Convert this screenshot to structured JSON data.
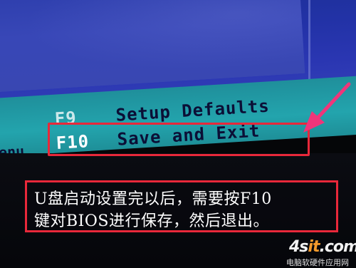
{
  "bios": {
    "help_items": [
      {
        "key": "F9",
        "description": "Setup Defaults"
      },
      {
        "key": "F10",
        "description": "Save and Exit"
      }
    ],
    "menu_fragment": "enu"
  },
  "annotation": {
    "line1": "U盘启动设置完以后，需要按F10",
    "line2": "键对BIOS进行保存，然后退出。"
  },
  "watermark": {
    "logo_main": "4s",
    "logo_accent": "it",
    "logo_tail": ".com",
    "subtitle": "电脑软硬件应用网"
  },
  "colors": {
    "bios_blue": "#2c3dab",
    "help_bar_teal": "#23a4ad",
    "highlight_red": "#e8283a",
    "arrow_pink": "#f0357a"
  }
}
